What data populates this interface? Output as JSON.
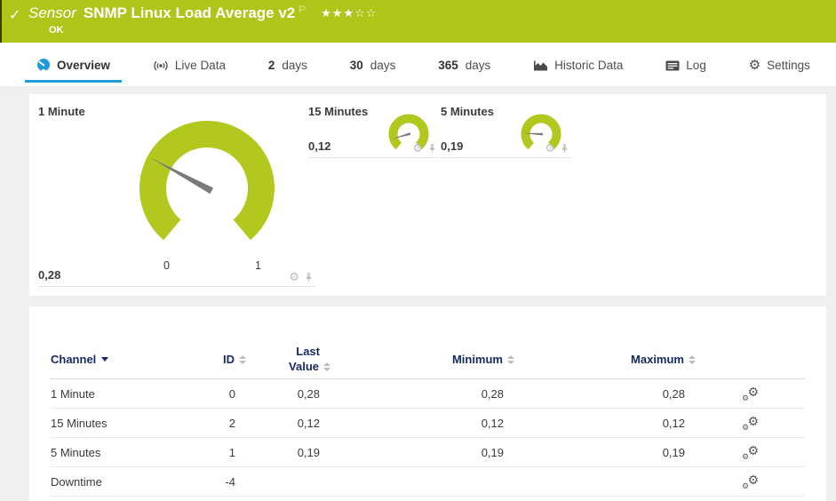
{
  "sensor_header": {
    "check_icon": "✓",
    "kind_label": "Sensor",
    "name": "SNMP Linux Load Average v2",
    "flag_icon": "⚐",
    "rating_filled": "★★★",
    "rating_empty": "☆☆",
    "status": "OK"
  },
  "tabs": [
    {
      "label": "Overview",
      "active": true
    },
    {
      "label": "Live Data"
    },
    {
      "bold": "2",
      "label": "days"
    },
    {
      "bold": "30",
      "label": "days"
    },
    {
      "bold": "365",
      "label": "days"
    },
    {
      "label": "Historic Data"
    },
    {
      "label": "Log"
    },
    {
      "label": "Settings"
    }
  ],
  "chart_data": [
    {
      "type": "gauge",
      "title": "1 Minute",
      "value": 0.28,
      "value_label": "0,28",
      "axis_min": 0,
      "axis_max": 1,
      "scale_ticks": [
        "0",
        "1"
      ]
    },
    {
      "type": "gauge",
      "title": "15 Minutes",
      "value": 0.12,
      "value_label": "0,12",
      "axis_min": 0,
      "axis_max": 1
    },
    {
      "type": "gauge",
      "title": "5 Minutes",
      "value": 0.19,
      "value_label": "0,19",
      "axis_min": 0,
      "axis_max": 1
    }
  ],
  "gauges": [
    {
      "title": "1 Minute",
      "value": "0,28",
      "numeric": 0.28,
      "scale_min": "0",
      "scale_max": "1"
    },
    {
      "title": "15 Minutes",
      "value": "0,12",
      "numeric": 0.12
    },
    {
      "title": "5 Minutes",
      "value": "0,19",
      "numeric": 0.19
    }
  ],
  "table": {
    "headers": {
      "channel": "Channel",
      "id": "ID",
      "last_line1": "Last",
      "last_line2": "Value",
      "min": "Minimum",
      "max": "Maximum"
    },
    "rows": [
      {
        "channel": "1 Minute",
        "id": "0",
        "last": "0,28",
        "min": "0,28",
        "max": "0,28"
      },
      {
        "channel": "15 Minutes",
        "id": "2",
        "last": "0,12",
        "min": "0,12",
        "max": "0,12"
      },
      {
        "channel": "5 Minutes",
        "id": "1",
        "last": "0,19",
        "min": "0,19",
        "max": "0,19"
      },
      {
        "channel": "Downtime",
        "id": "-4",
        "last": "",
        "min": "",
        "max": ""
      }
    ]
  },
  "colors": {
    "brand_green": "#aec51a",
    "gauge_green": "#b2c81e",
    "accent_blue": "#1e9cd7",
    "header_navy": "#15295f",
    "needle_gray": "#7a7a7a"
  }
}
